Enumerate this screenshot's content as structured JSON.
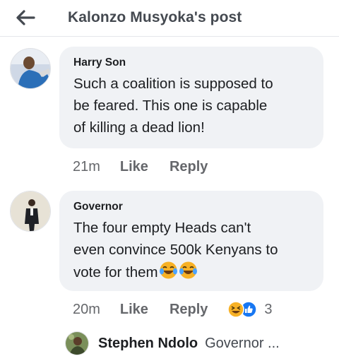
{
  "header": {
    "back_icon": "arrow-left-icon",
    "title": "Kalonzo Musyoka's post"
  },
  "comments": [
    {
      "author": "Harry Son",
      "lines": [
        "Such a coalition is supposed to",
        "be feared. This one is capable",
        "of killing a dead lion!"
      ],
      "time": "21m",
      "like_label": "Like",
      "reply_label": "Reply"
    },
    {
      "author": "Governor",
      "lines": [
        "The four empty Heads can't",
        "even convince 500k Kenyans to",
        "vote for them"
      ],
      "emojis": [
        "face-with-tears-of-joy",
        "face-with-tears-of-joy"
      ],
      "time": "20m",
      "like_label": "Like",
      "reply_label": "Reply",
      "reactions": [
        "haha-reaction",
        "like-reaction"
      ],
      "reaction_count": "3"
    }
  ],
  "reply_preview": {
    "author": "Stephen Ndolo",
    "snippet": "Governor ..."
  },
  "colors": {
    "bubble": "#f0f2f5",
    "muted_text": "#65676b",
    "like_blue": "#1877f2",
    "emoji_yellow": "#f7b125"
  }
}
